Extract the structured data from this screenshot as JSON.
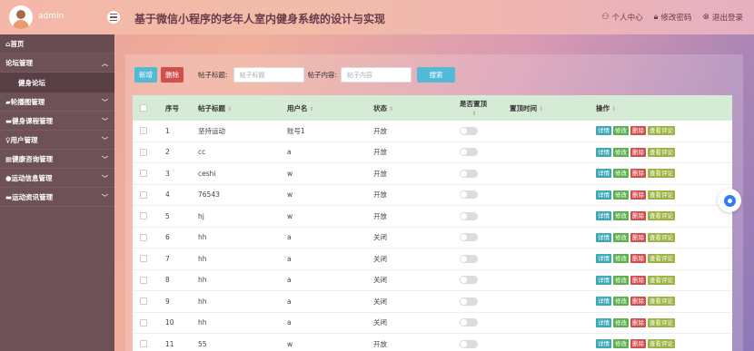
{
  "header": {
    "username": "admin",
    "title": "基于微信小程序的老年人室内健身系统的设计与实现",
    "actions": {
      "profile": "个人中心",
      "change_password": "修改密码",
      "logout": "退出登录"
    }
  },
  "sidebar": {
    "home": "首页",
    "forum": "论坛管理",
    "forum_sub": "健身论坛",
    "items": [
      "轮播图管理",
      "健身课程管理",
      "用户管理",
      "健康咨询管理",
      "运动信息管理",
      "运动资讯管理"
    ]
  },
  "toolbar": {
    "add": "新增",
    "delete": "删除",
    "title_label": "帖子标题:",
    "title_placeholder": "帖子标题",
    "content_label": "帖子内容:",
    "content_placeholder": "帖子内容",
    "search": "搜索"
  },
  "table": {
    "headers": {
      "no": "序号",
      "title": "帖子标题",
      "user": "用户名",
      "status": "状态",
      "pinned": "是否置顶",
      "pin_time": "置顶时间",
      "ops": "操作"
    },
    "ops": [
      "详情",
      "修改",
      "删除",
      "查看评论"
    ],
    "rows": [
      {
        "no": "1",
        "title": "坚持运动",
        "user": "账号1",
        "status": "开放"
      },
      {
        "no": "2",
        "title": "cc",
        "user": "a",
        "status": "开放"
      },
      {
        "no": "3",
        "title": "ceshi",
        "user": "w",
        "status": "开放"
      },
      {
        "no": "4",
        "title": "76543",
        "user": "w",
        "status": "开放"
      },
      {
        "no": "5",
        "title": "hj",
        "user": "w",
        "status": "开放"
      },
      {
        "no": "6",
        "title": "hh",
        "user": "a",
        "status": "关闭"
      },
      {
        "no": "7",
        "title": "hh",
        "user": "a",
        "status": "关闭"
      },
      {
        "no": "8",
        "title": "hh",
        "user": "a",
        "status": "关闭"
      },
      {
        "no": "9",
        "title": "hh",
        "user": "a",
        "status": "关闭"
      },
      {
        "no": "10",
        "title": "hh",
        "user": "a",
        "status": "关闭"
      },
      {
        "no": "11",
        "title": "55",
        "user": "w",
        "status": "开放"
      }
    ]
  }
}
